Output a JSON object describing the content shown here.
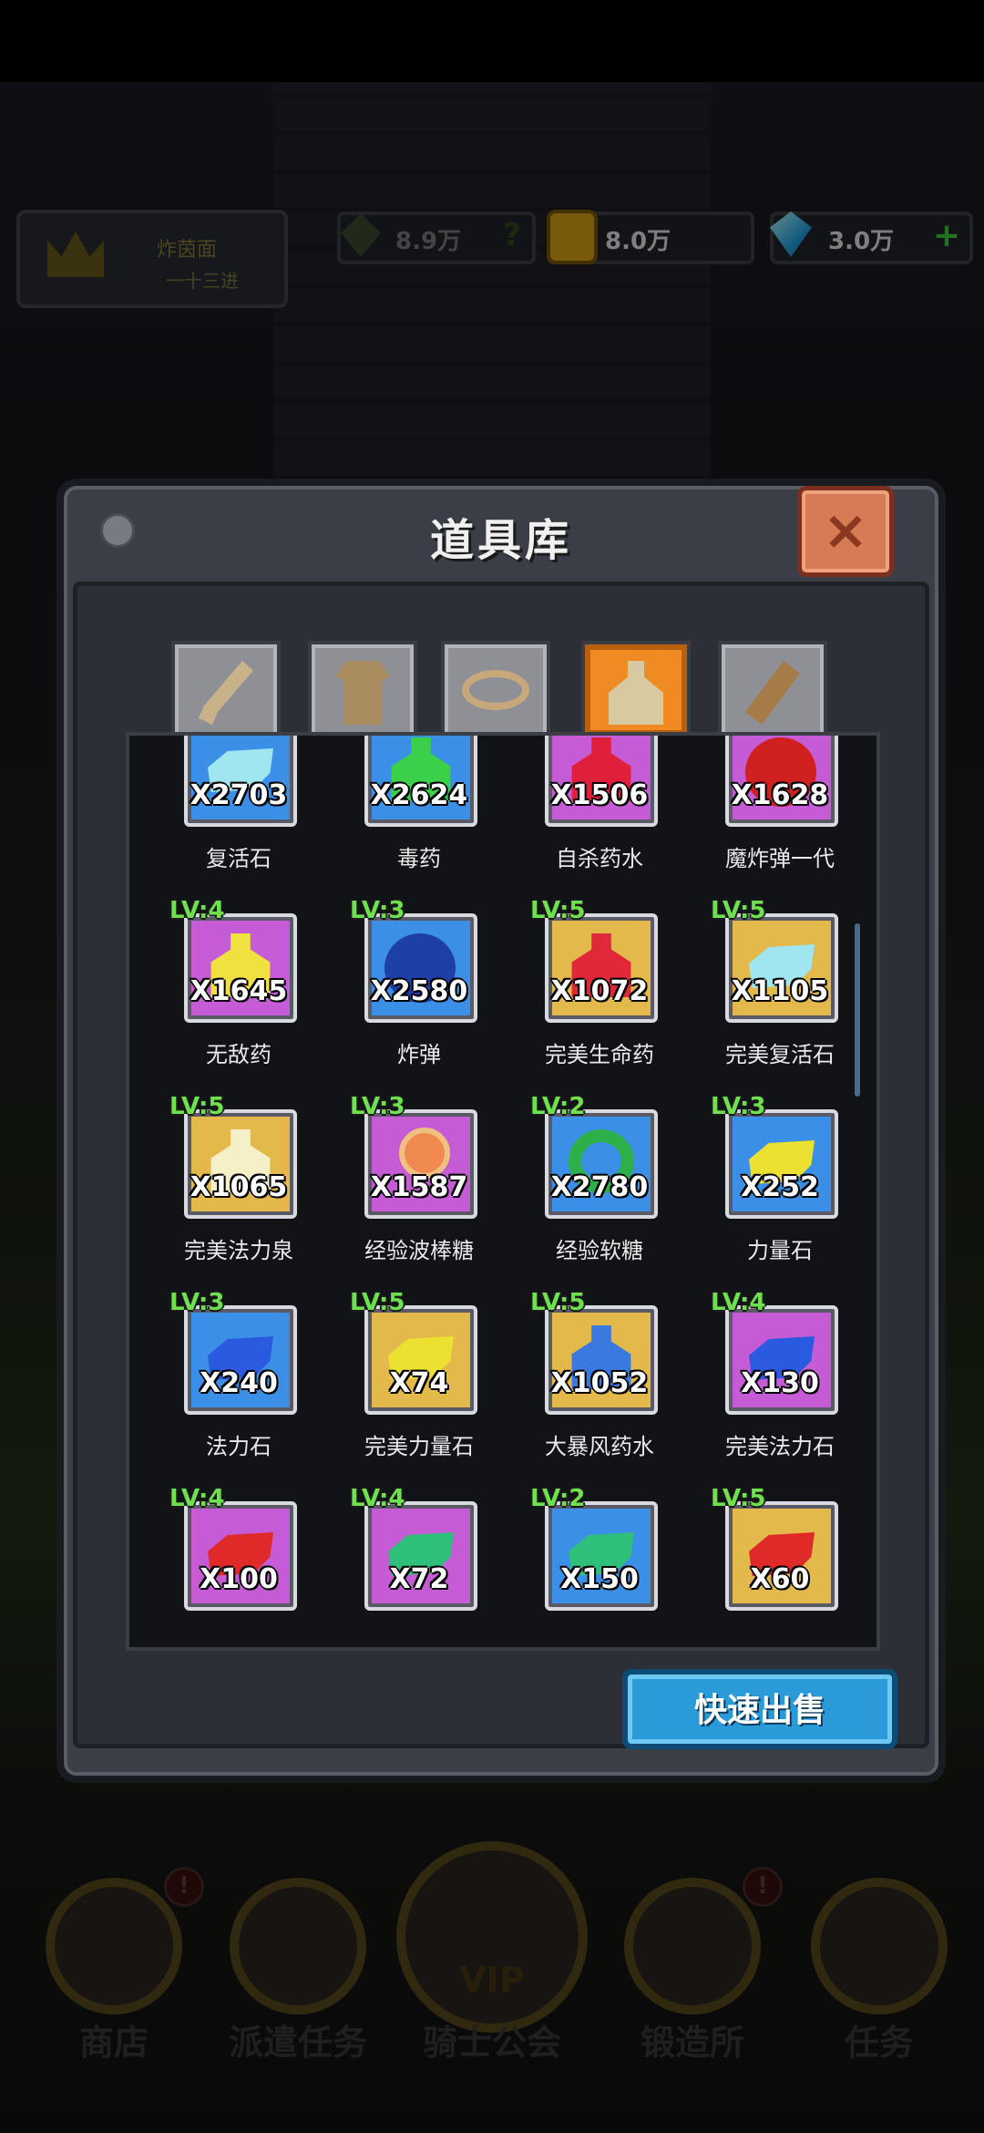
{
  "hud": {
    "crown_line1": "炸茵面",
    "crown_line2": "一十三进",
    "power": "8.9万",
    "gold": "8.0万",
    "gems": "3.0万",
    "power_hint": "?",
    "add": "+"
  },
  "dialog": {
    "title": "道具库",
    "close": "×",
    "sell_label": "快速出售",
    "tabs": [
      {
        "id": "weapon",
        "icon": "sword-icon"
      },
      {
        "id": "armor",
        "icon": "armor-icon"
      },
      {
        "id": "ring",
        "icon": "ring-icon"
      },
      {
        "id": "consumable",
        "icon": "potion-icon",
        "active": true
      },
      {
        "id": "material",
        "icon": "wood-icon"
      }
    ]
  },
  "items": [
    {
      "name": "复活石",
      "qty": "X2703",
      "lv": "",
      "bg": "blue",
      "shape": "stone",
      "color": "#9fe6f0"
    },
    {
      "name": "毒药",
      "qty": "X2624",
      "lv": "",
      "bg": "blue",
      "shape": "bottle",
      "color": "#3ad04a"
    },
    {
      "name": "自杀药水",
      "qty": "X1506",
      "lv": "",
      "bg": "pink",
      "shape": "bottle",
      "color": "#e0203a"
    },
    {
      "name": "魔炸弹一代",
      "qty": "X1628",
      "lv": "",
      "bg": "pink",
      "shape": "orb",
      "color": "#d02020"
    },
    {
      "name": "无敌药",
      "qty": "X1645",
      "lv": "LV:4",
      "bg": "pink",
      "shape": "bottle",
      "color": "#f0e040"
    },
    {
      "name": "炸弹",
      "qty": "X2580",
      "lv": "LV:3",
      "bg": "blue",
      "shape": "orb",
      "color": "#1e3fa8"
    },
    {
      "name": "完美生命药",
      "qty": "X1072",
      "lv": "LV:5",
      "bg": "gold",
      "shape": "bottle",
      "color": "#e02838"
    },
    {
      "name": "完美复活石",
      "qty": "X1105",
      "lv": "LV:5",
      "bg": "gold",
      "shape": "stone",
      "color": "#9fe6f0"
    },
    {
      "name": "完美法力泉",
      "qty": "X1065",
      "lv": "LV:5",
      "bg": "gold",
      "shape": "bottle",
      "color": "#f6f0c8"
    },
    {
      "name": "经验波棒糖",
      "qty": "X1587",
      "lv": "LV:3",
      "bg": "pink",
      "shape": "lolly",
      "color": "#f08a50"
    },
    {
      "name": "经验软糖",
      "qty": "X2780",
      "lv": "LV:2",
      "bg": "blue",
      "shape": "ring",
      "color": "#2db04a"
    },
    {
      "name": "力量石",
      "qty": "X252",
      "lv": "LV:3",
      "bg": "blue",
      "shape": "stone",
      "color": "#ece030"
    },
    {
      "name": "法力石",
      "qty": "X240",
      "lv": "LV:3",
      "bg": "blue",
      "shape": "stone",
      "color": "#2a5ae0"
    },
    {
      "name": "完美力量石",
      "qty": "X74",
      "lv": "LV:5",
      "bg": "gold",
      "shape": "stone",
      "color": "#ece030"
    },
    {
      "name": "大暴风药水",
      "qty": "X1052",
      "lv": "LV:5",
      "bg": "gold",
      "shape": "bottle",
      "color": "#3a7ae0"
    },
    {
      "name": "完美法力石",
      "qty": "X130",
      "lv": "LV:4",
      "bg": "pink",
      "shape": "stone",
      "color": "#2a5ae0"
    },
    {
      "name": "",
      "qty": "X100",
      "lv": "LV:4",
      "bg": "pink",
      "shape": "stone",
      "color": "#e02a2a"
    },
    {
      "name": "",
      "qty": "X72",
      "lv": "LV:4",
      "bg": "pink",
      "shape": "stone",
      "color": "#2ec07a"
    },
    {
      "name": "",
      "qty": "X150",
      "lv": "LV:2",
      "bg": "blue",
      "shape": "stone",
      "color": "#2ec07a"
    },
    {
      "name": "",
      "qty": "X60",
      "lv": "LV:5",
      "bg": "gold",
      "shape": "stone",
      "color": "#e02a2a"
    }
  ],
  "nav": [
    {
      "label": "商店",
      "badge": "!"
    },
    {
      "label": "派遣任务",
      "badge": ""
    },
    {
      "label": "骑士公会",
      "badge": "",
      "vip": "VIP"
    },
    {
      "label": "锻造所",
      "badge": "!"
    },
    {
      "label": "任务",
      "badge": ""
    }
  ]
}
